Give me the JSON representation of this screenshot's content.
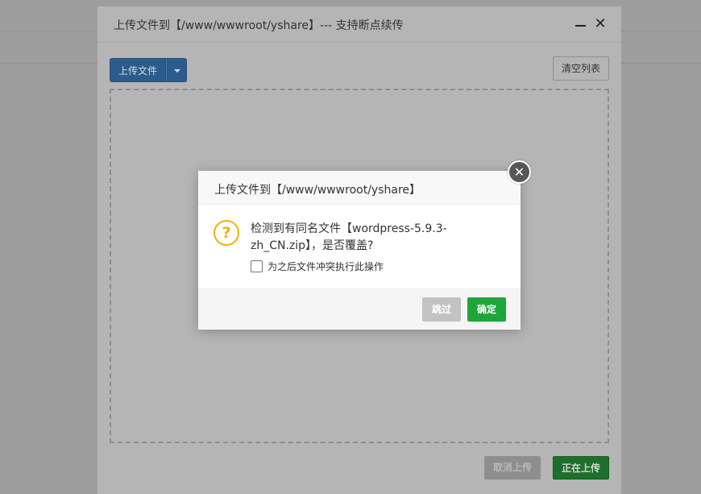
{
  "upload_dialog": {
    "title": "上传文件到【/www/wwwroot/yshare】--- 支持断点续传",
    "upload_button": "上传文件",
    "clear_list_button": "清空列表",
    "cancel_upload_button": "取消上传",
    "uploading_button": "正在上传",
    "close_symbol": "✕"
  },
  "confirm_modal": {
    "title": "上传文件到【/www/wwwroot/yshare】",
    "message": "检测到有同名文件【wordpress-5.9.3-zh_CN.zip】，是否覆盖?",
    "icon_glyph": "?",
    "checkbox_label": "为之后文件冲突执行此操作",
    "skip_button": "跳过",
    "confirm_button": "确定",
    "close_symbol": "✕"
  },
  "colors": {
    "primary": "#2c5c8e",
    "success": "#20a53a",
    "warning_icon": "#f0b400"
  }
}
